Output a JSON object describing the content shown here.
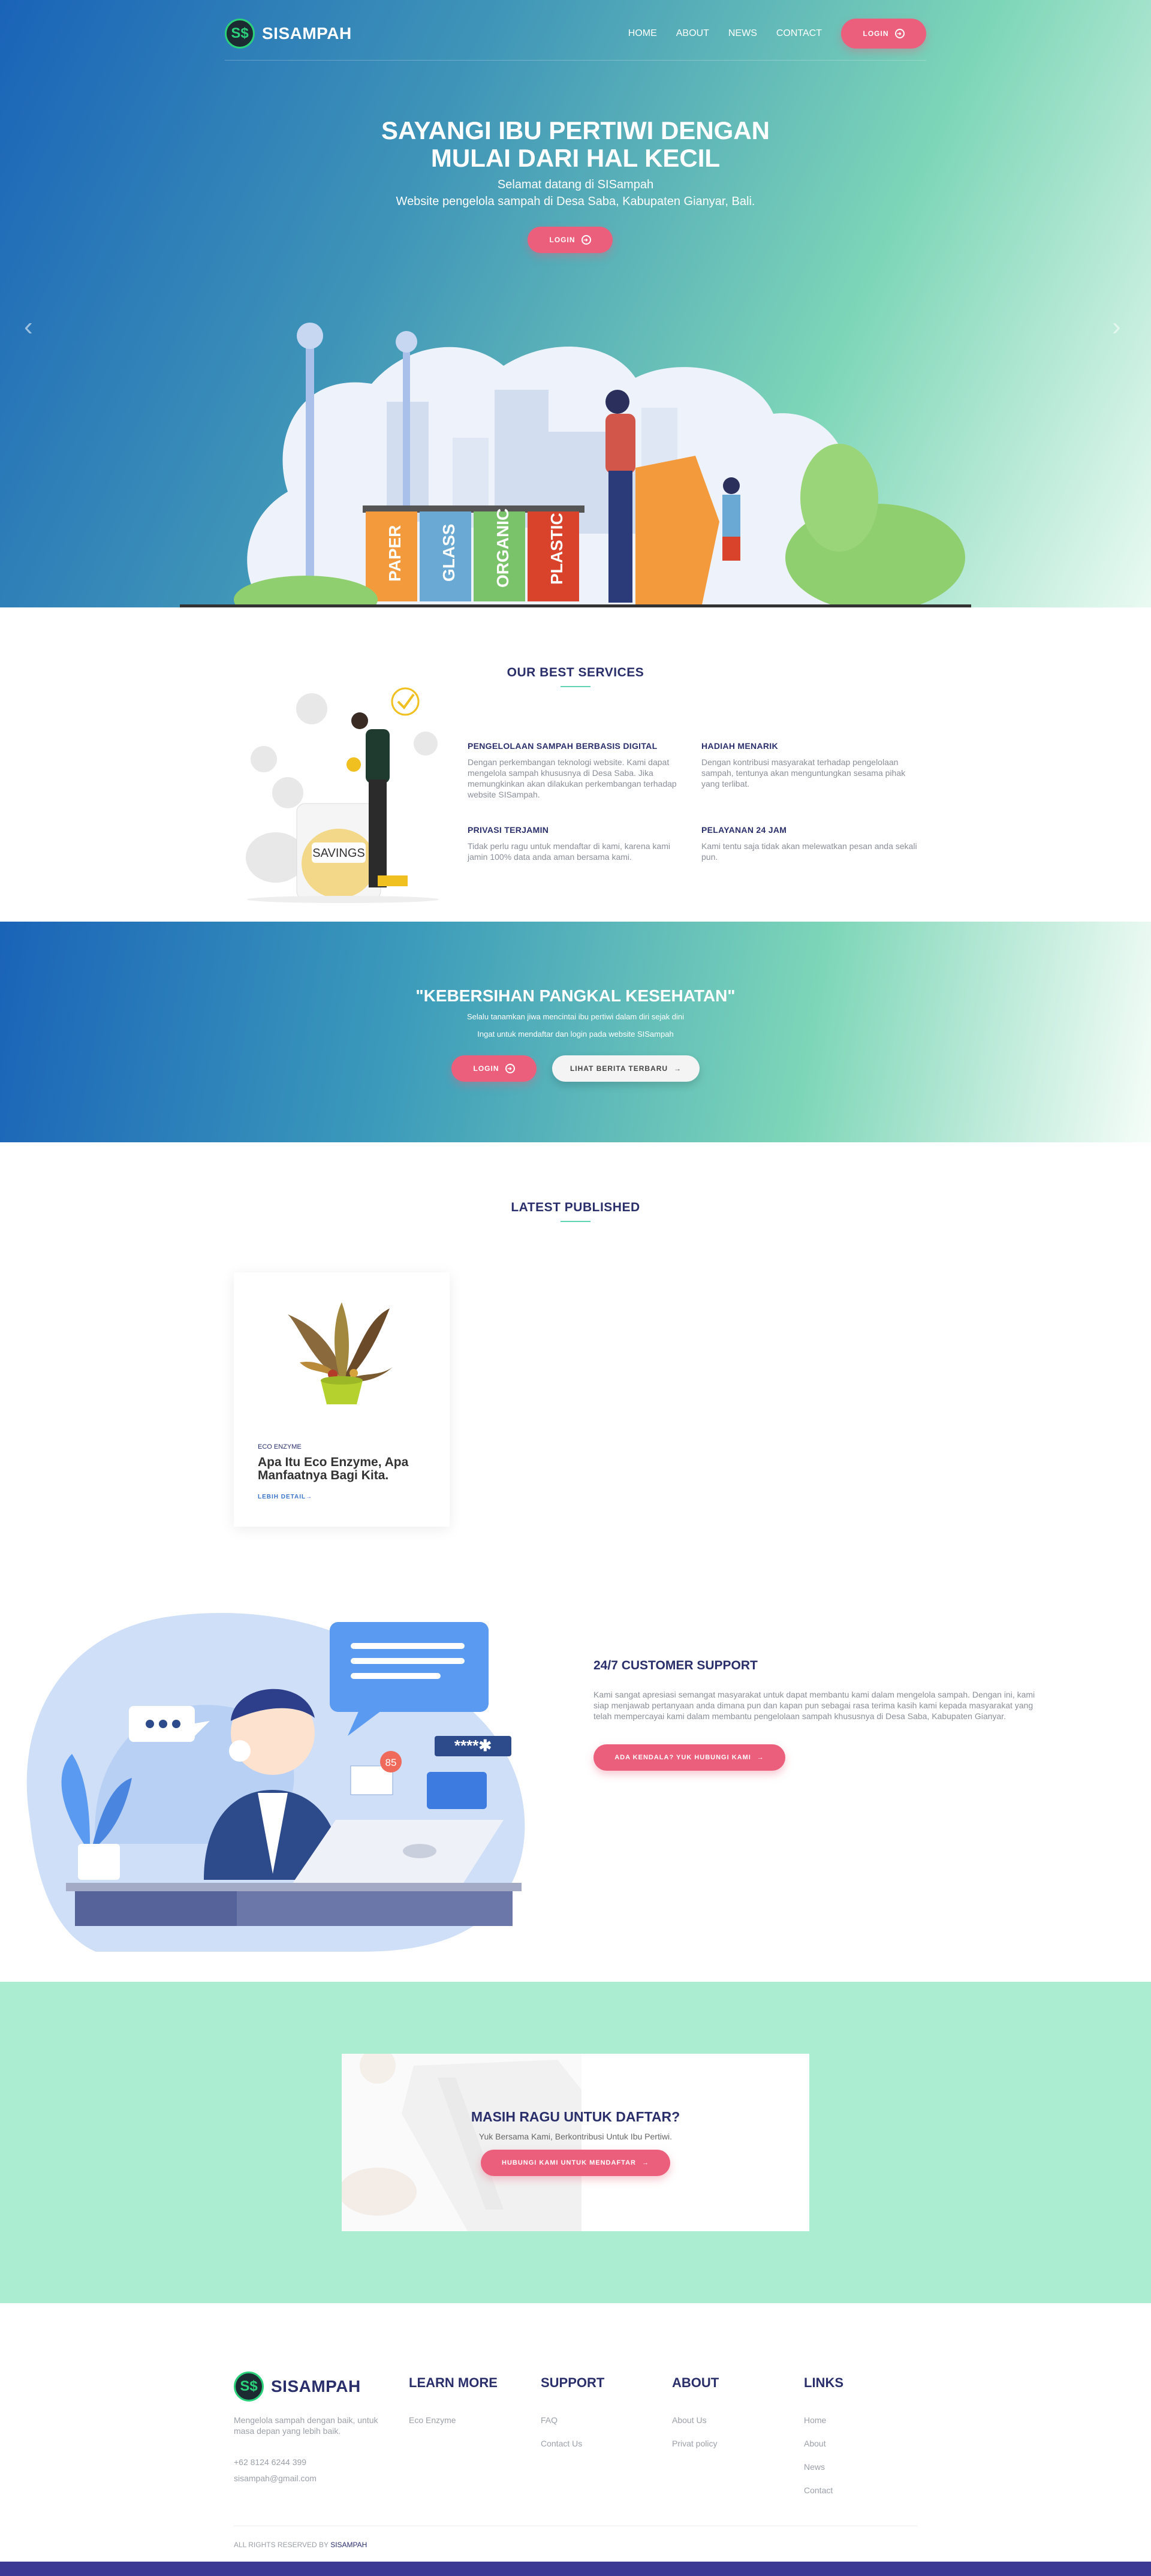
{
  "brand": {
    "logo_letters": "S$",
    "name": "SISAMPAH"
  },
  "nav": {
    "links": [
      "HOME",
      "ABOUT",
      "NEWS",
      "CONTACT"
    ],
    "login": "LOGIN"
  },
  "hero": {
    "title_line1": "SAYANGI IBU PERTIWI DENGAN",
    "title_line2": "MULAI DARI HAL KECIL",
    "subtitle1": "Selamat datang di SISampah",
    "subtitle2": "Website pengelola sampah di Desa Saba, Kabupaten Gianyar, Bali.",
    "login": "LOGIN",
    "prev_arrow": "‹",
    "next_arrow": "›",
    "bin_labels": [
      "PAPER",
      "GLASS",
      "ORGANIC",
      "PLASTIC"
    ]
  },
  "services": {
    "title": "OUR BEST SERVICES",
    "savings_label": "SAVINGS",
    "items": [
      {
        "title": "PENGELOLAAN SAMPAH BERBASIS DIGITAL",
        "text": "Dengan perkembangan teknologi website. Kami dapat mengelola sampah khususnya di Desa Saba. Jika memungkinkan akan dilakukan perkembangan terhadap website SISampah."
      },
      {
        "title": "HADIAH MENARIK",
        "text": "Dengan kontribusi masyarakat terhadap pengelolaan sampah, tentunya akan menguntungkan sesama pihak yang terlibat."
      },
      {
        "title": "PRIVASI TERJAMIN",
        "text": "Tidak perlu ragu untuk mendaftar di kami, karena kami jamin 100% data anda aman bersama kami."
      },
      {
        "title": "PELAYANAN 24 JAM",
        "text": "Kami tentu saja tidak akan melewatkan pesan anda sekali pun."
      }
    ]
  },
  "band": {
    "title": "\"KEBERSIHAN PANGKAL KESEHATAN\"",
    "sub1": "Selalu tanamkan jiwa mencintai ibu pertiwi dalam diri sejak dini",
    "sub2": "Ingat untuk mendaftar dan login pada website SISampah",
    "login": "LOGIN",
    "news": "LIHAT BERITA TERBARU"
  },
  "latest": {
    "title": "LATEST PUBLISHED",
    "card": {
      "tag": "ECO ENZYME",
      "title": "Apa Itu Eco Enzyme, Apa Manfaatnya Bagi Kita.",
      "link": "LEBIH DETAIL→"
    }
  },
  "support": {
    "title": "24/7 CUSTOMER SUPPORT",
    "text": "Kami sangat apresiasi semangat masyarakat untuk dapat membantu kami dalam mengelola sampah. Dengan ini, kami siap menjawab pertanyaan anda dimana pun dan kapan pun sebagai rasa terima kasih kami kepada masyarakat yang telah mempercayai kami dalam membantu pengelolaan sampah khususnya di Desa Saba, Kabupaten Gianyar.",
    "button": "ADA KENDALA? YUK HUBUNGI KAMI",
    "badge": "85",
    "password_mask": "****✱"
  },
  "cta": {
    "title": "MASIH RAGU UNTUK DAFTAR?",
    "sub": "Yuk Bersama Kami, Berkontribusi Untuk Ibu Pertiwi.",
    "button": "HUBUNGI KAMI UNTUK MENDAFTAR"
  },
  "footer": {
    "about_text": "Mengelola sampah dengan baik, untuk masa depan yang lebih baik.",
    "phone": "+62 8124 6244 399",
    "email": "sisampah@gmail.com",
    "learn_title": "LEARN MORE",
    "learn_links": [
      "Eco Enzyme"
    ],
    "support_title": "SUPPORT",
    "support_links": [
      "FAQ",
      "Contact Us"
    ],
    "about_title": "ABOUT",
    "about_links": [
      "About Us",
      "Privat policy"
    ],
    "links_title": "LINKS",
    "links": [
      "Home",
      "About",
      "News",
      "Contact"
    ],
    "copyright_prefix": "ALL RIGHTS RESERVED BY",
    "copyright_brand": "SISAMPAH"
  },
  "colors": {
    "accent_pink": "#eb5e7c",
    "navy": "#2a2f6b",
    "mint": "#aaedd1",
    "blue": "#1a63b8"
  }
}
